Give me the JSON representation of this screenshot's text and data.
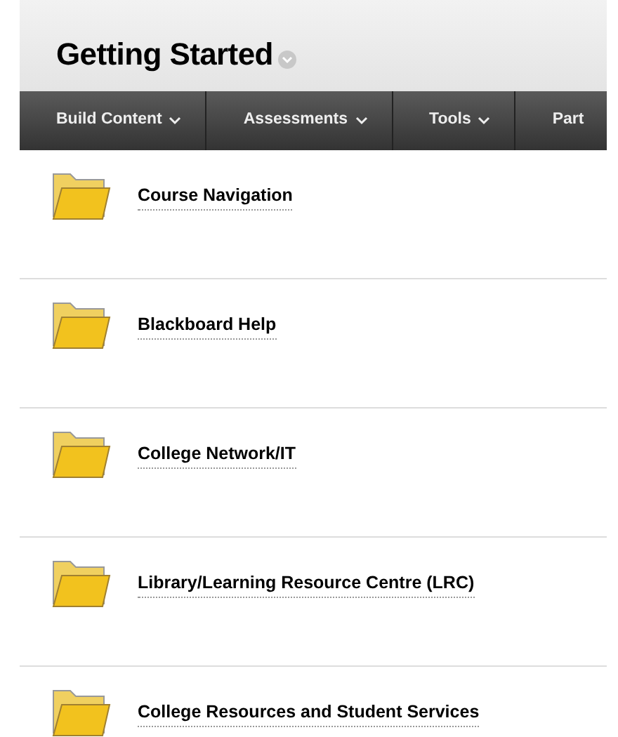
{
  "page_title": "Getting Started",
  "toolbar": [
    {
      "label": "Build Content",
      "dropdown": true
    },
    {
      "label": "Assessments",
      "dropdown": true
    },
    {
      "label": "Tools",
      "dropdown": true
    },
    {
      "label": "Part",
      "dropdown": false
    }
  ],
  "items": [
    {
      "title": "Course Navigation"
    },
    {
      "title": "Blackboard Help"
    },
    {
      "title": "College Network/IT"
    },
    {
      "title": "Library/Learning Resource Centre (LRC)"
    },
    {
      "title": "College Resources and Student Services"
    }
  ]
}
